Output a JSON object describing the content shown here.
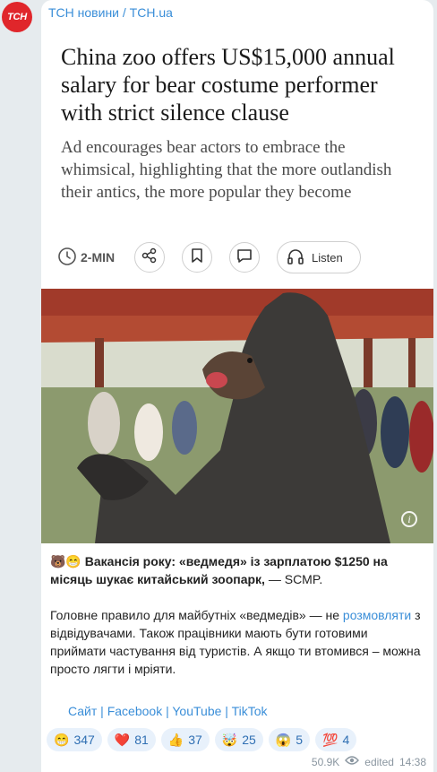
{
  "channel": {
    "avatar_text": "ТСН",
    "name": "ТСН новини / TCH.ua"
  },
  "article_card": {
    "headline": "China zoo offers US$15,000 annual salary for bear costume performer with strict silence clause",
    "subhead": "Ad encourages bear actors to embrace the whimsical, highlighting that the more outlandish their antics, the more popular they become",
    "read_time": "2-MIN",
    "listen_label": "Listen"
  },
  "post": {
    "line1_emoji": "🐻😁",
    "line1": "Вакансія року: «ведмедя» із зарплатою $1250 на місяць шукає китайський зоопарк,",
    "line1_source": " — SCMP.",
    "para2_before": "Головне правило для майбутніх «ведмедів» — не ",
    "para2_link": "розмовляти",
    "para2_after": " з відвідувачами. Також працівники мають бути готовими приймати частування від туристів. А якщо ти втомився – можна просто лягти і мріяти."
  },
  "links": {
    "site": "Сайт",
    "facebook": "Facebook",
    "youtube": "YouTube",
    "tiktok": "TikTok",
    "sep": " | "
  },
  "reactions": [
    {
      "emoji": "😁",
      "count": "347"
    },
    {
      "emoji": "❤️",
      "count": "81"
    },
    {
      "emoji": "👍",
      "count": "37"
    },
    {
      "emoji": "🤯",
      "count": "25"
    },
    {
      "emoji": "😱",
      "count": "5"
    },
    {
      "emoji": "💯",
      "count": "4"
    }
  ],
  "meta": {
    "views": "50.9K",
    "edited": "edited",
    "time": "14:38"
  }
}
